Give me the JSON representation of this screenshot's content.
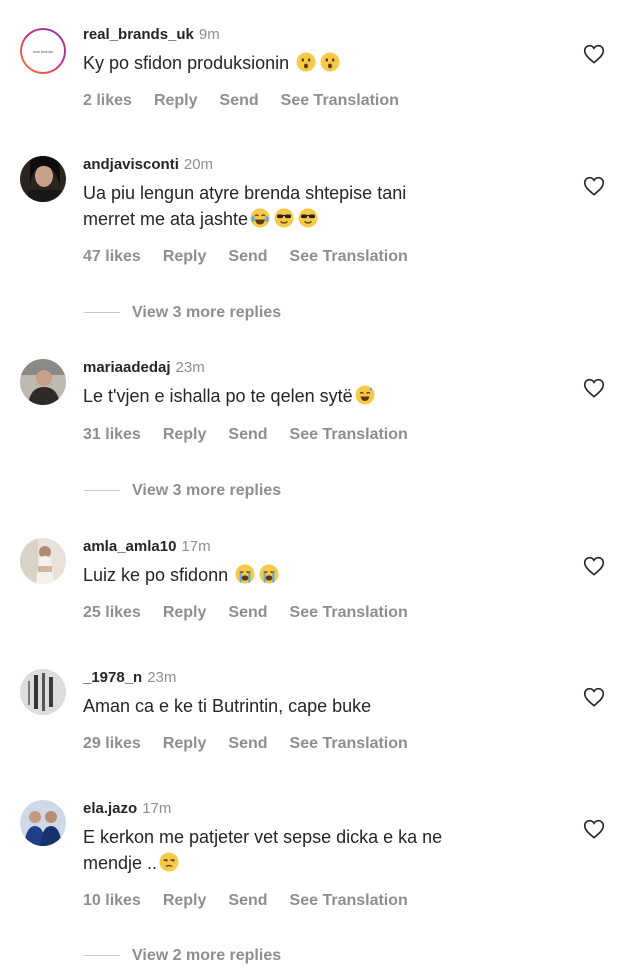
{
  "comments": [
    {
      "username": "real_brands_uk",
      "time": "9m",
      "text": "Ky po sfidon produksionin",
      "emojis": [
        "hushed-face-emoji",
        "hushed-face-emoji"
      ],
      "likes": "2 likes",
      "reply": "Reply",
      "send": "Send",
      "translate": "See Translation",
      "avatar_logo_text": "real brands"
    },
    {
      "username": "andjavisconti",
      "time": "20m",
      "text_line1": "Ua piu lengun atyre brenda shtepise tani",
      "text_line2": "merret me ata jashte",
      "emojis": [
        "tears-of-joy-emoji",
        "sunglasses-face-emoji",
        "sunglasses-face-emoji"
      ],
      "likes": "47 likes",
      "reply": "Reply",
      "send": "Send",
      "translate": "See Translation",
      "more_replies": "View 3 more replies"
    },
    {
      "username": "mariaadedaj",
      "time": "23m",
      "text": "Le t'vjen e ishalla po te qelen sytë",
      "emojis": [
        "sweat-smile-emoji"
      ],
      "likes": "31 likes",
      "reply": "Reply",
      "send": "Send",
      "translate": "See Translation",
      "more_replies": "View 3 more replies"
    },
    {
      "username": "amla_amla10",
      "time": "17m",
      "text": "Luiz ke po sfidonn",
      "emojis": [
        "loudly-crying-emoji",
        "loudly-crying-emoji"
      ],
      "likes": "25 likes",
      "reply": "Reply",
      "send": "Send",
      "translate": "See Translation"
    },
    {
      "username": "_1978_n",
      "time": "23m",
      "text": "Aman ca e ke ti Butrintin, cape buke",
      "likes": "29 likes",
      "reply": "Reply",
      "send": "Send",
      "translate": "See Translation"
    },
    {
      "username": "ela.jazo",
      "time": "17m",
      "text_line1": "E kerkon me patjeter vet sepse dicka e ka ne",
      "text_line2": "mendje ..",
      "emojis": [
        "unamused-face-emoji"
      ],
      "likes": "10 likes",
      "reply": "Reply",
      "send": "Send",
      "translate": "See Translation",
      "more_replies": "View 2 more replies"
    }
  ],
  "icons": {
    "like": "heart-outline-icon"
  },
  "colors": {
    "text": "#262626",
    "secondary": "#8e8e8e",
    "emoji": "#f7c948",
    "story_ring": "#c13584"
  }
}
